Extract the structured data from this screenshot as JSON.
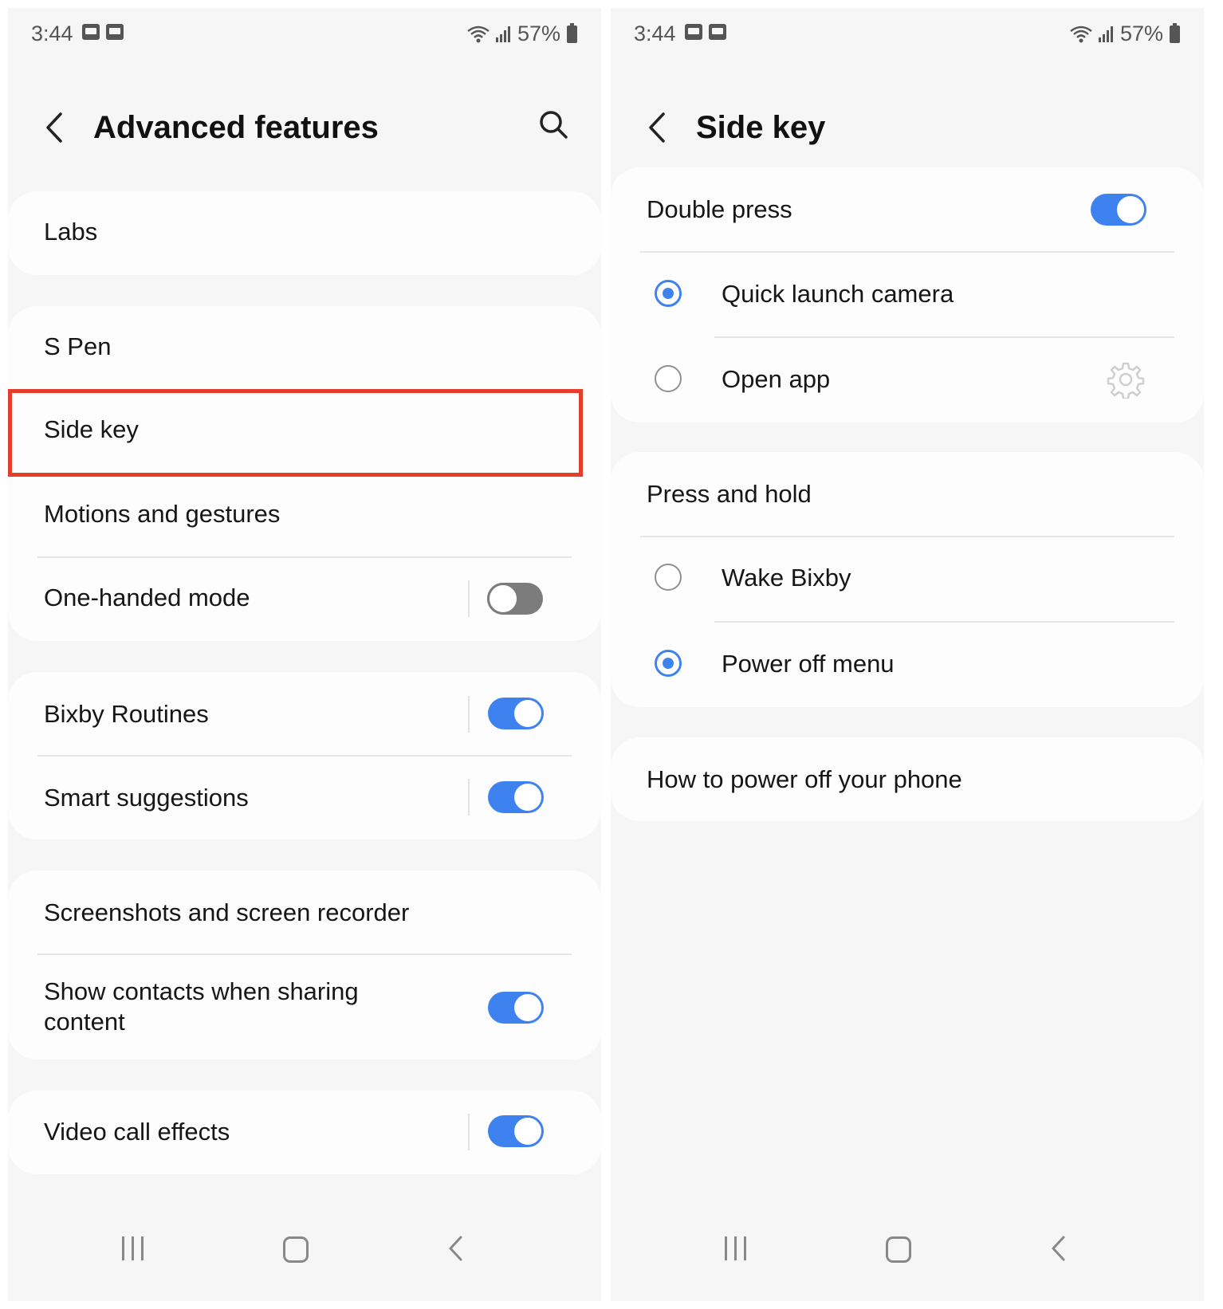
{
  "status_bar": {
    "time": "3:44",
    "battery": "57%"
  },
  "left_screen": {
    "title": "Advanced features",
    "items": {
      "labs": "Labs",
      "s_pen": "S Pen",
      "side_key": "Side key",
      "motions": "Motions and gestures",
      "one_handed": "One-handed mode",
      "bixby_routines": "Bixby Routines",
      "smart_suggestions": "Smart suggestions",
      "screenshots": "Screenshots and screen recorder",
      "show_contacts_line1": "Show contacts when sharing",
      "show_contacts_line2": "content",
      "video_call": "Video call effects"
    },
    "toggles": {
      "one_handed": false,
      "bixby_routines": true,
      "smart_suggestions": true,
      "show_contacts": true,
      "video_call": true
    }
  },
  "right_screen": {
    "title": "Side key",
    "double_press": {
      "label": "Double press",
      "enabled": true,
      "options": [
        "Quick launch camera",
        "Open app"
      ],
      "selected": "Quick launch camera"
    },
    "press_and_hold": {
      "label": "Press and hold",
      "options": [
        "Wake Bixby",
        "Power off menu"
      ],
      "selected": "Power off menu"
    },
    "help_link": "How to power off your phone"
  },
  "colors": {
    "accent": "#3e82f0",
    "highlight": "#e33d2b",
    "background": "#f6f6f6"
  },
  "icons": [
    "back-icon",
    "search-icon",
    "gear-icon",
    "wifi-icon",
    "signal-icon",
    "battery-icon",
    "gallery-icon",
    "nav-recents-icon",
    "nav-home-icon",
    "nav-back-icon"
  ]
}
